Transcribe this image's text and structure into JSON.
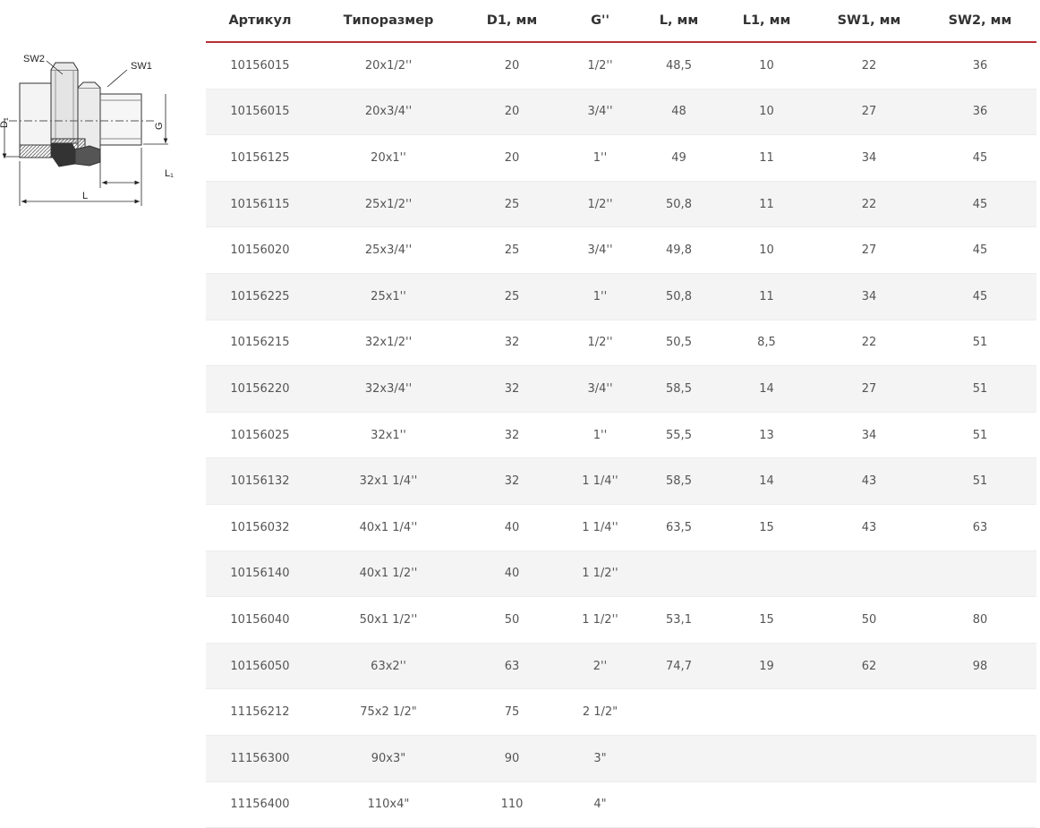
{
  "drawing": {
    "labels": {
      "sw2": "SW2",
      "sw1": "SW1",
      "d1": "D₁",
      "g": "G",
      "l": "L",
      "l1": "L₁"
    }
  },
  "table": {
    "columns": [
      "Артикул",
      "Типоразмер",
      "D1, мм",
      "G''",
      "L, мм",
      "L1, мм",
      "SW1, мм",
      "SW2, мм"
    ],
    "rows": [
      [
        "10156015",
        "20x1/2''",
        "20",
        "1/2''",
        "48,5",
        "10",
        "22",
        "36"
      ],
      [
        "10156015",
        "20x3/4''",
        "20",
        "3/4''",
        "48",
        "10",
        "27",
        "36"
      ],
      [
        "10156125",
        "20x1''",
        "20",
        "1''",
        "49",
        "11",
        "34",
        "45"
      ],
      [
        "10156115",
        "25x1/2''",
        "25",
        "1/2''",
        "50,8",
        "11",
        "22",
        "45"
      ],
      [
        "10156020",
        "25x3/4''",
        "25",
        "3/4''",
        "49,8",
        "10",
        "27",
        "45"
      ],
      [
        "10156225",
        "25x1''",
        "25",
        "1''",
        "50,8",
        "11",
        "34",
        "45"
      ],
      [
        "10156215",
        "32x1/2''",
        "32",
        "1/2''",
        "50,5",
        "8,5",
        "22",
        "51"
      ],
      [
        "10156220",
        "32x3/4''",
        "32",
        "3/4''",
        "58,5",
        "14",
        "27",
        "51"
      ],
      [
        "10156025",
        "32x1''",
        "32",
        "1''",
        "55,5",
        "13",
        "34",
        "51"
      ],
      [
        "10156132",
        "32x1 1/4''",
        "32",
        "1 1/4''",
        "58,5",
        "14",
        "43",
        "51"
      ],
      [
        "10156032",
        "40x1 1/4''",
        "40",
        "1 1/4''",
        "63,5",
        "15",
        "43",
        "63"
      ],
      [
        "10156140",
        "40x1 1/2''",
        "40",
        "1 1/2''",
        "",
        "",
        "",
        ""
      ],
      [
        "10156040",
        "50x1 1/2''",
        "50",
        "1 1/2''",
        "53,1",
        "15",
        "50",
        "80"
      ],
      [
        "10156050",
        "63x2''",
        "63",
        "2''",
        "74,7",
        "19",
        "62",
        "98"
      ],
      [
        "11156212",
        "75x2 1/2\"",
        "75",
        "2 1/2\"",
        "",
        "",
        "",
        ""
      ],
      [
        "11156300",
        "90x3\"",
        "90",
        "3\"",
        "",
        "",
        "",
        ""
      ],
      [
        "11156400",
        "110x4\"",
        "110",
        "4\"",
        "",
        "",
        "",
        ""
      ]
    ]
  },
  "colors": {
    "accent": "#b72f35",
    "stripe": "#f4f4f4",
    "text": "#555555"
  }
}
